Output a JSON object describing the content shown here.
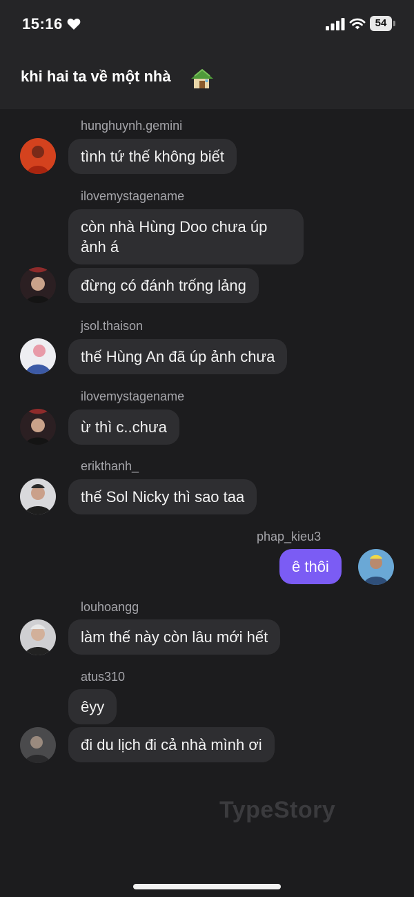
{
  "status_bar": {
    "time": "15:16",
    "battery": "54",
    "icons": [
      "heart-icon",
      "signal-icon",
      "wifi-icon",
      "battery-icon"
    ]
  },
  "header": {
    "title": "khi hai ta về một nhà",
    "icon": "house-icon"
  },
  "messages": [
    {
      "sender": "hunghuynh.gemini",
      "lines": [
        "tình tứ thế không biết"
      ]
    },
    {
      "sender": "ilovemystagename",
      "lines": [
        "còn nhà Hùng Doo chưa úp ảnh á",
        "đừng có đánh trống lảng"
      ]
    },
    {
      "sender": "jsol.thaison",
      "lines": [
        "thế Hùng An đã úp ảnh chưa"
      ]
    },
    {
      "sender": "ilovemystagename",
      "lines": [
        "ừ thì c..chưa"
      ]
    },
    {
      "sender": "erikthanh_",
      "lines": [
        "thế Sol Nicky thì sao taa"
      ]
    },
    {
      "sender": "phap_kieu3",
      "lines": [
        "ê thôi"
      ],
      "outgoing": true
    },
    {
      "sender": "louhoangg",
      "lines": [
        "làm thế này còn lâu mới hết"
      ]
    },
    {
      "sender": "atus310",
      "lines": [
        "êyy",
        "đi du lịch đi cả nhà mình ơi"
      ]
    }
  ],
  "watermark": "TypeStory",
  "colors": {
    "background": "#1c1c1e",
    "header": "#252527",
    "bubble_incoming": "#2e2e31",
    "bubble_outgoing": "#7b5cf4"
  }
}
